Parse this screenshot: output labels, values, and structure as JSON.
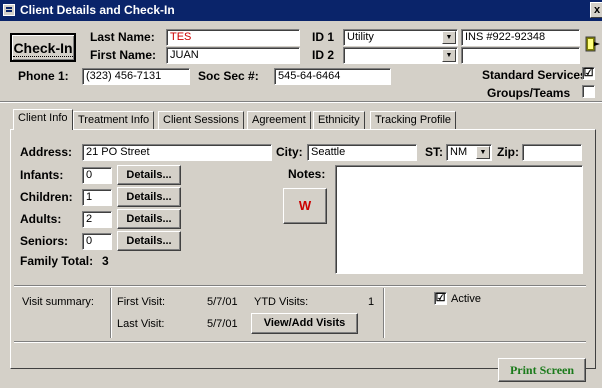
{
  "window": {
    "title": "Client Details and Check-In",
    "close_glyph": "x"
  },
  "header": {
    "checkin_label": "Check-In",
    "last_name_label": "Last Name:",
    "last_name_value": "TES",
    "first_name_label": "First Name:",
    "first_name_value": "JUAN",
    "id1_label": "ID 1",
    "id1_type": "Utility",
    "id1_value": "INS #922-92348",
    "id2_label": "ID 2",
    "id2_type": "",
    "id2_value": "",
    "phone1_label": "Phone 1:",
    "phone1_value": "(323) 456-7131",
    "ssn_label": "Soc Sec #:",
    "ssn_value": "545-64-6464",
    "standard_services_label": "Standard Services",
    "standard_services_checked": "☑",
    "groups_teams_label": "Groups/Teams",
    "groups_teams_checked": ""
  },
  "tabs": [
    {
      "label": "Client Info"
    },
    {
      "label": "Treatment Info"
    },
    {
      "label": "Client Sessions"
    },
    {
      "label": "Agreement"
    },
    {
      "label": "Ethnicity"
    },
    {
      "label": "Tracking Profile"
    }
  ],
  "client_info": {
    "address_label": "Address:",
    "address_value": "21 PO Street",
    "city_label": "City:",
    "city_value": "Seattle",
    "st_label": "ST:",
    "st_value": "NM",
    "zip_label": "Zip:",
    "zip_value": "",
    "infants_label": "Infants:",
    "infants_value": "0",
    "children_label": "Children:",
    "children_value": "1",
    "adults_label": "Adults:",
    "adults_value": "2",
    "seniors_label": "Seniors:",
    "seniors_value": "0",
    "details_label": "Details...",
    "family_total_label": "Family Total:",
    "family_total_value": "3",
    "notes_label": "Notes:",
    "w_button_label": "W"
  },
  "visit_summary": {
    "label": "Visit summary:",
    "first_visit_label": "First Visit:",
    "first_visit_value": "5/7/01",
    "last_visit_label": "Last Visit:",
    "last_visit_value": "5/7/01",
    "ytd_label": "YTD Visits:",
    "ytd_value": "1",
    "view_add_label": "View/Add Visits",
    "active_label": "Active",
    "active_checked": "☑"
  },
  "footer": {
    "print_screen_label": "Print Screen"
  },
  "colors": {
    "title_bar": "#0a246a",
    "face": "#d4d0c8",
    "print_screen_text": "#1a7a1a",
    "name_text": "#cc0000"
  }
}
